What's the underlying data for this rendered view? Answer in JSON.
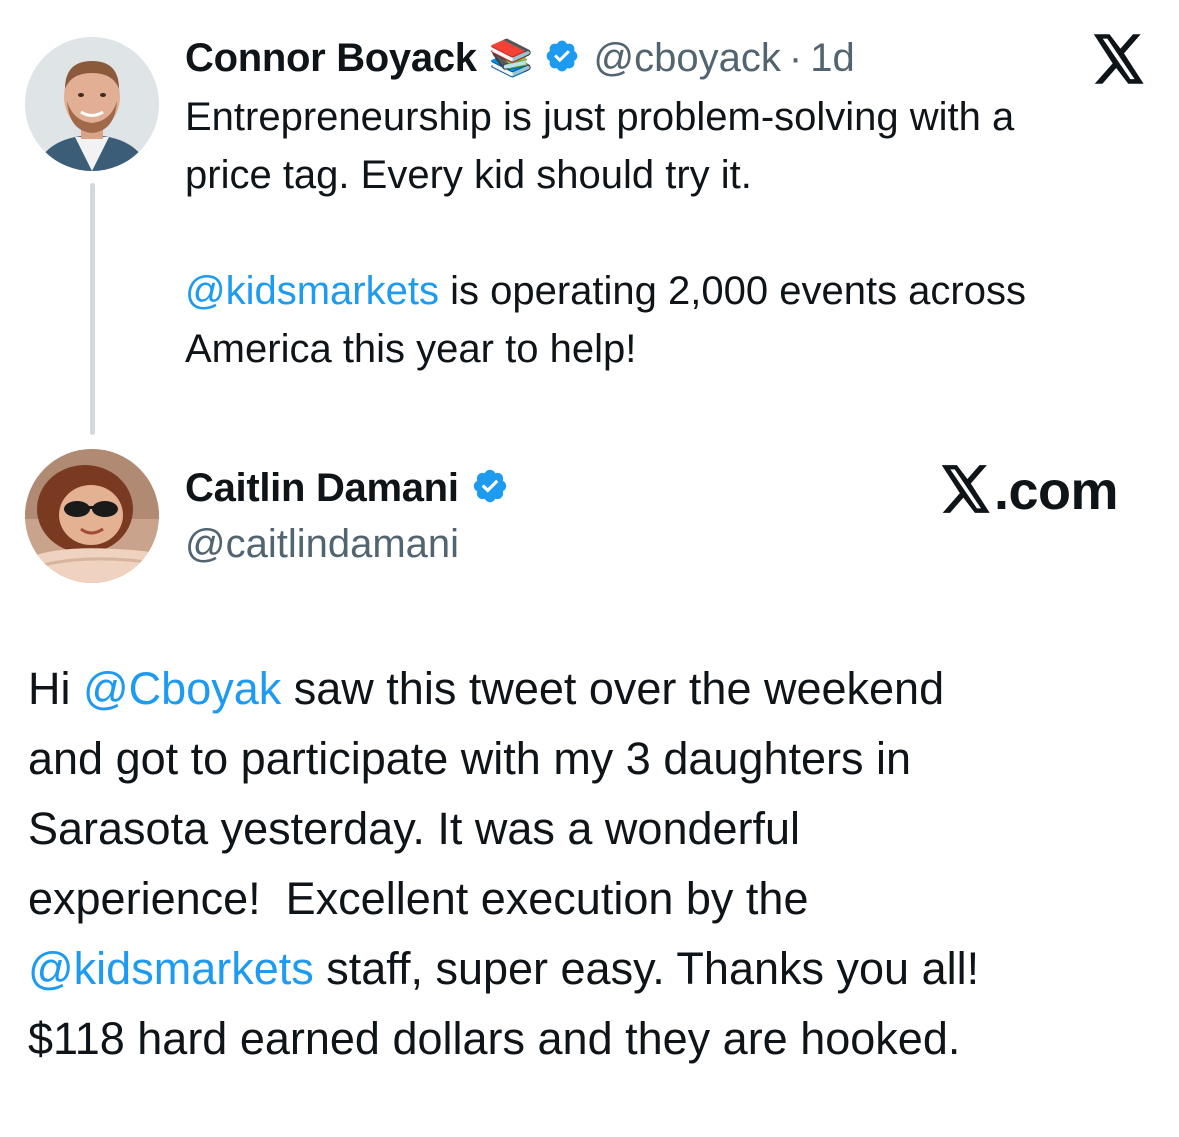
{
  "original_tweet": {
    "author_name": "Connor Boyack",
    "author_emoji": "📚",
    "verified": true,
    "handle": "@cboyack",
    "separator": "·",
    "time": "1d",
    "text_line_1": "Entrepreneurship is just problem-solving with a",
    "text_line_2": "price tag. Every kid should try it.",
    "mention_1": "@kidsmarkets",
    "text_line_3_rest": " is operating 2,000 events across",
    "text_line_4": "America this year to help!"
  },
  "reply": {
    "author_name": "Caitlin Damani",
    "verified": true,
    "handle": "@caitlindamani",
    "site_label": ".com",
    "text_1": "Hi ",
    "mention_1": "@Cboyak",
    "text_2": " saw this tweet over the weekend",
    "text_line_2": "and got to participate with my 3 daughters in",
    "text_line_3": "Sarasota yesterday. It was a wonderful",
    "text_line_4": "experience!  Excellent execution by the",
    "mention_2": "@kidsmarkets",
    "text_line_5_rest": " staff, super easy. Thanks you all!",
    "text_line_6": "$118 hard earned dollars and they are hooked."
  },
  "colors": {
    "accent": "#1d9bf0",
    "text": "#0f1419",
    "secondary_text": "#536471",
    "thread_line": "#cfd9de"
  },
  "icons": {
    "verified": "verified-badge-icon",
    "x_logo": "x-logo-icon"
  }
}
